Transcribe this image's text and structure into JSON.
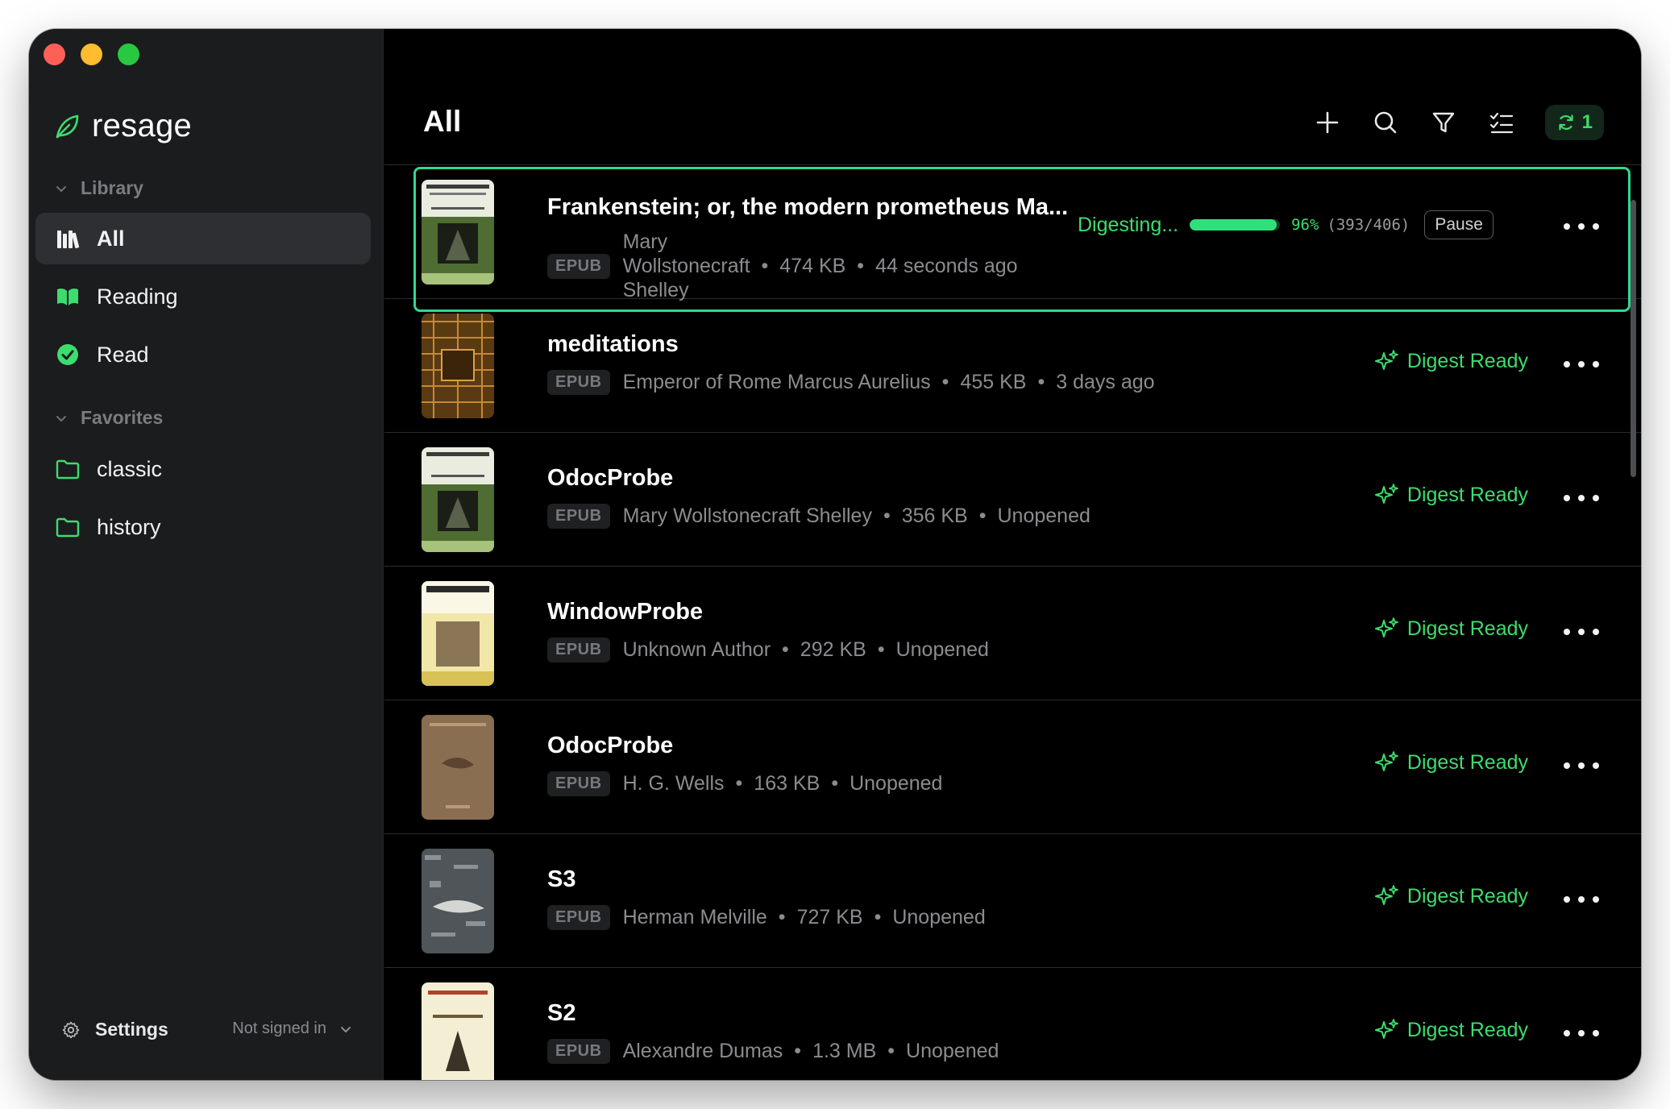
{
  "app": {
    "name": "resage",
    "accent": "#3ddc6e"
  },
  "sidebar": {
    "library_header": "Library",
    "items": [
      {
        "label": "All",
        "icon": "books-icon",
        "active": true
      },
      {
        "label": "Reading",
        "icon": "open-book-icon"
      },
      {
        "label": "Read",
        "icon": "check-circle-icon"
      }
    ],
    "favorites_header": "Favorites",
    "favorites": [
      {
        "label": "classic",
        "icon": "folder-icon"
      },
      {
        "label": "history",
        "icon": "folder-icon"
      }
    ],
    "settings_label": "Settings",
    "account_status": "Not signed in"
  },
  "main": {
    "title": "All",
    "toolbar": {
      "add_icon": "plus-icon",
      "search_icon": "search-icon",
      "filter_icon": "filter-icon",
      "select_icon": "checklist-icon",
      "sync_count": "1"
    },
    "books": [
      {
        "title": "Frankenstein; or, the modern prometheus Ma...",
        "format": "EPUB",
        "author_lines": [
          "Mary",
          "Wollstonecraft",
          "Shelley"
        ],
        "size": "474 KB",
        "opened": "44 seconds ago",
        "status": "digesting",
        "progress_label": "Digesting...",
        "progress_fraction": 0.96,
        "progress_pct": "96%",
        "progress_count": "(393/406)",
        "pause_label": "Pause"
      },
      {
        "title": "meditations",
        "format": "EPUB",
        "author": "Emperor of Rome Marcus Aurelius",
        "size": "455 KB",
        "opened": "3 days ago",
        "status_label": "Digest Ready"
      },
      {
        "title": "OdocProbe",
        "format": "EPUB",
        "author": "Mary Wollstonecraft Shelley",
        "size": "356 KB",
        "opened": "Unopened",
        "status_label": "Digest Ready"
      },
      {
        "title": "WindowProbe",
        "format": "EPUB",
        "author": "Unknown Author",
        "size": "292 KB",
        "opened": "Unopened",
        "status_label": "Digest Ready"
      },
      {
        "title": "OdocProbe",
        "format": "EPUB",
        "author": "H. G. Wells",
        "size": "163 KB",
        "opened": "Unopened",
        "status_label": "Digest Ready"
      },
      {
        "title": "S3",
        "format": "EPUB",
        "author": "Herman Melville",
        "size": "727 KB",
        "opened": "Unopened",
        "status_label": "Digest Ready"
      },
      {
        "title": "S2",
        "format": "EPUB",
        "author": "Alexandre Dumas",
        "size": "1.3 MB",
        "opened": "Unopened",
        "status_label": "Digest Ready"
      }
    ]
  }
}
